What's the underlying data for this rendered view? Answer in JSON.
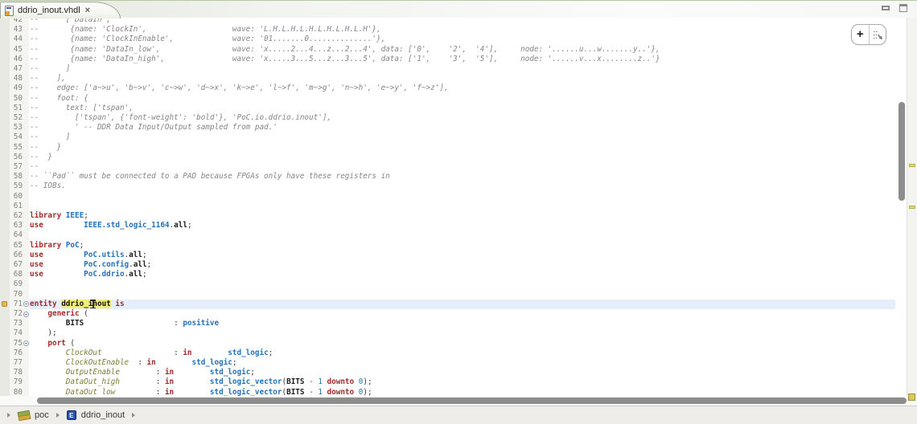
{
  "tab": {
    "title": "ddrio_inout.vhdl",
    "close_glyph": "×"
  },
  "window_controls": {
    "minimize": "minimize-view",
    "maximize": "maximize-view"
  },
  "floating_toolbar": {
    "plus_label": "+"
  },
  "breadcrumb": {
    "items": [
      {
        "icon": "vhdl-library-icon",
        "label": "poc"
      },
      {
        "icon": "vhdl-entity-icon",
        "entity_glyph": "E",
        "label": "ddrio_inout"
      }
    ]
  },
  "colors": {
    "keyword": "#a22b2b",
    "type": "#2272bd",
    "comment": "#858585",
    "port_signal": "#7d7d35",
    "occurrence_bg": "#f2ee79",
    "current_line_bg": "#e4effb",
    "overview_marker": "#ded878"
  },
  "editor": {
    "current_line": 71,
    "cursor": {
      "line": 71,
      "col": 14
    },
    "lines": [
      {
        "n": 42,
        "seg": [
          [
            "c",
            "--      ['DataIn',"
          ]
        ]
      },
      {
        "n": 43,
        "seg": [
          [
            "c",
            "--       {name: 'ClockIn',                   wave: 'L.H.L.H.L.H.L.H.L.H.L.H'},"
          ]
        ]
      },
      {
        "n": 44,
        "seg": [
          [
            "c",
            "--       {name: 'ClockInEnable',             wave: '01.......0..............'},"
          ]
        ]
      },
      {
        "n": 45,
        "seg": [
          [
            "c",
            "--       {name: 'DataIn_low',                wave: 'x.....2...4...z...2...4', data: ['0',    '2',  '4'],     node: '......u...w.......y..'},"
          ]
        ]
      },
      {
        "n": 46,
        "seg": [
          [
            "c",
            "--       {name: 'DataIn_high',               wave: 'x.....3...5...z...3...5', data: ['1',    '3',  '5'],     node: '......v...x........z..'}"
          ]
        ]
      },
      {
        "n": 47,
        "seg": [
          [
            "c",
            "--      ]"
          ]
        ]
      },
      {
        "n": 48,
        "seg": [
          [
            "c",
            "--    ],"
          ]
        ]
      },
      {
        "n": 49,
        "seg": [
          [
            "c",
            "--    edge: ['a~>u', 'b~>v', 'c~>w', 'd~>x', 'k~>e', 'l~>f', 'm~>g', 'n~>h', 'e~>y', 'f~>z'],"
          ]
        ]
      },
      {
        "n": 50,
        "seg": [
          [
            "c",
            "--    foot: {"
          ]
        ]
      },
      {
        "n": 51,
        "seg": [
          [
            "c",
            "--      text: ['tspan',"
          ]
        ]
      },
      {
        "n": 52,
        "seg": [
          [
            "c",
            "--        ['tspan', {'font-weight': 'bold'}, 'PoC.io.ddrio.inout'],"
          ]
        ]
      },
      {
        "n": 53,
        "seg": [
          [
            "c",
            "--        ' -- DDR Data Input/Output sampled from pad.'"
          ]
        ]
      },
      {
        "n": 54,
        "seg": [
          [
            "c",
            "--      ]"
          ]
        ]
      },
      {
        "n": 55,
        "seg": [
          [
            "c",
            "--    }"
          ]
        ]
      },
      {
        "n": 56,
        "seg": [
          [
            "c",
            "--  }"
          ]
        ]
      },
      {
        "n": 57,
        "seg": [
          [
            "c",
            "--"
          ]
        ]
      },
      {
        "n": 58,
        "seg": [
          [
            "c",
            "-- ``Pad`` must be connected to a PAD because FPGAs only have these registers in"
          ]
        ]
      },
      {
        "n": 59,
        "seg": [
          [
            "c",
            "-- IOBs."
          ]
        ]
      },
      {
        "n": 60,
        "seg": []
      },
      {
        "n": 61,
        "seg": []
      },
      {
        "n": 62,
        "seg": [
          [
            "k",
            "library"
          ],
          [
            "p",
            " "
          ],
          [
            "t",
            "IEEE"
          ],
          [
            "p",
            ";"
          ]
        ]
      },
      {
        "n": 63,
        "seg": [
          [
            "k",
            "use"
          ],
          [
            "p",
            "         "
          ],
          [
            "t",
            "IEEE.std_logic_1164"
          ],
          [
            "p",
            "."
          ],
          [
            "b",
            "all"
          ],
          [
            "p",
            ";"
          ]
        ]
      },
      {
        "n": 64,
        "seg": []
      },
      {
        "n": 65,
        "seg": [
          [
            "k",
            "library"
          ],
          [
            "p",
            " "
          ],
          [
            "t",
            "PoC"
          ],
          [
            "p",
            ";"
          ]
        ]
      },
      {
        "n": 66,
        "seg": [
          [
            "k",
            "use"
          ],
          [
            "p",
            "         "
          ],
          [
            "t",
            "PoC.utils"
          ],
          [
            "p",
            "."
          ],
          [
            "b",
            "all"
          ],
          [
            "p",
            ";"
          ]
        ]
      },
      {
        "n": 67,
        "seg": [
          [
            "k",
            "use"
          ],
          [
            "p",
            "         "
          ],
          [
            "t",
            "PoC.config"
          ],
          [
            "p",
            "."
          ],
          [
            "b",
            "all"
          ],
          [
            "p",
            ";"
          ]
        ]
      },
      {
        "n": 68,
        "seg": [
          [
            "k",
            "use"
          ],
          [
            "p",
            "         "
          ],
          [
            "t",
            "PoC.ddrio"
          ],
          [
            "p",
            "."
          ],
          [
            "b",
            "all"
          ],
          [
            "p",
            ";"
          ]
        ]
      },
      {
        "n": 69,
        "seg": []
      },
      {
        "n": 70,
        "seg": []
      },
      {
        "n": 71,
        "fold": true,
        "marker": true,
        "seg": [
          [
            "k",
            "entity"
          ],
          [
            "p",
            " "
          ],
          [
            "h",
            "ddrio_inout"
          ],
          [
            "p",
            " "
          ],
          [
            "k",
            "is"
          ]
        ]
      },
      {
        "n": 72,
        "fold": true,
        "seg": [
          [
            "p",
            "    "
          ],
          [
            "k",
            "generic"
          ],
          [
            "p",
            " ("
          ]
        ]
      },
      {
        "n": 73,
        "seg": [
          [
            "p",
            "        "
          ],
          [
            "b",
            "BITS"
          ],
          [
            "p",
            "                    : "
          ],
          [
            "t",
            "positive"
          ]
        ]
      },
      {
        "n": 74,
        "seg": [
          [
            "p",
            "    );"
          ]
        ]
      },
      {
        "n": 75,
        "fold": true,
        "seg": [
          [
            "p",
            "    "
          ],
          [
            "k",
            "port"
          ],
          [
            "p",
            " ("
          ]
        ]
      },
      {
        "n": 76,
        "seg": [
          [
            "p",
            "        "
          ],
          [
            "v",
            "ClockOut"
          ],
          [
            "p",
            "                : "
          ],
          [
            "k",
            "in"
          ],
          [
            "p",
            "        "
          ],
          [
            "t",
            "std_logic"
          ],
          [
            "p",
            ";"
          ]
        ]
      },
      {
        "n": 77,
        "seg": [
          [
            "p",
            "        "
          ],
          [
            "v",
            "ClockOutEnable"
          ],
          [
            "p",
            "  : "
          ],
          [
            "k",
            "in"
          ],
          [
            "p",
            "        "
          ],
          [
            "t",
            "std_logic"
          ],
          [
            "p",
            ";"
          ]
        ]
      },
      {
        "n": 78,
        "seg": [
          [
            "p",
            "        "
          ],
          [
            "v",
            "OutputEnable"
          ],
          [
            "p",
            "        : "
          ],
          [
            "k",
            "in"
          ],
          [
            "p",
            "        "
          ],
          [
            "t",
            "std_logic"
          ],
          [
            "p",
            ";"
          ]
        ]
      },
      {
        "n": 79,
        "seg": [
          [
            "p",
            "        "
          ],
          [
            "v",
            "DataOut_high"
          ],
          [
            "p",
            "        : "
          ],
          [
            "k",
            "in"
          ],
          [
            "p",
            "        "
          ],
          [
            "t",
            "std_logic_vector"
          ],
          [
            "p",
            "("
          ],
          [
            "b",
            "BITS"
          ],
          [
            "p",
            " "
          ],
          [
            "o",
            "-"
          ],
          [
            "p",
            " "
          ],
          [
            "n",
            "1"
          ],
          [
            "p",
            " "
          ],
          [
            "k",
            "downto"
          ],
          [
            "p",
            " "
          ],
          [
            "n",
            "0"
          ],
          [
            "p",
            ");"
          ]
        ]
      },
      {
        "n": 80,
        "seg": [
          [
            "p",
            "        "
          ],
          [
            "v",
            "DataOut_low"
          ],
          [
            "p",
            "         : "
          ],
          [
            "k",
            "in"
          ],
          [
            "p",
            "        "
          ],
          [
            "t",
            "std_logic_vector"
          ],
          [
            "p",
            "("
          ],
          [
            "b",
            "BITS"
          ],
          [
            "p",
            " "
          ],
          [
            "o",
            "-"
          ],
          [
            "p",
            " "
          ],
          [
            "n",
            "1"
          ],
          [
            "p",
            " "
          ],
          [
            "k",
            "downto"
          ],
          [
            "p",
            " "
          ],
          [
            "n",
            "0"
          ],
          [
            "p",
            ");"
          ]
        ]
      }
    ]
  }
}
